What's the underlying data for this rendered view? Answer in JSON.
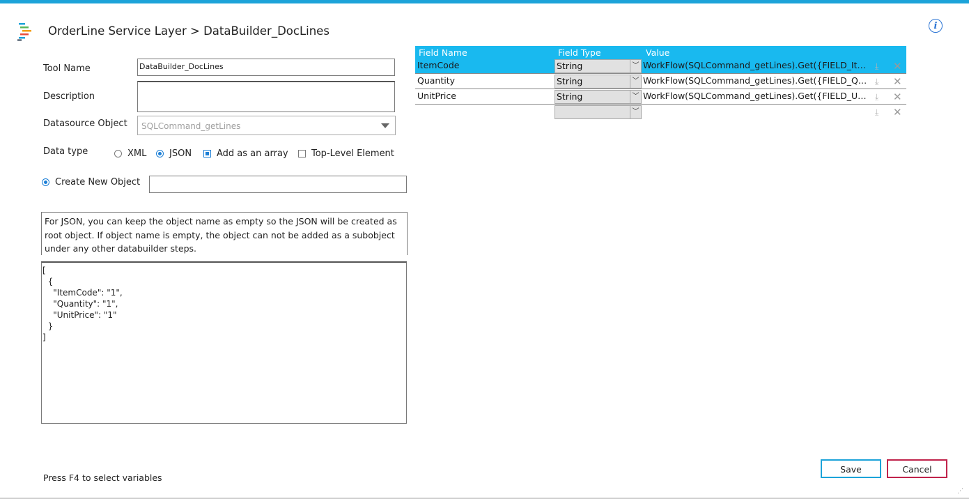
{
  "header": {
    "title": "OrderLine Service Layer > DataBuilder_DocLines"
  },
  "form": {
    "tool_name_label": "Tool Name",
    "tool_name_value": "DataBuilder_DocLines",
    "description_label": "Description",
    "description_value": "",
    "datasource_label": "Datasource Object",
    "datasource_value": "SQLCommand_getLines",
    "data_type_label": "Data type",
    "xml_label": "XML",
    "json_label": "JSON",
    "add_array_label": "Add as an array",
    "top_level_label": "Top-Level Element",
    "create_new_label": "Create New Object",
    "create_new_value": "",
    "note": "For JSON, you can keep the object name as empty so the JSON will be created as root object.  If object name is empty, the object can not be added as a subobject under any other databuilder steps.",
    "preview": "[\n  {\n    \"ItemCode\": \"1\",\n    \"Quantity\": \"1\",\n    \"UnitPrice\": \"1\"\n  }\n]"
  },
  "grid": {
    "headers": {
      "field_name": "Field Name",
      "field_type": "Field Type",
      "value": "Value"
    },
    "rows": [
      {
        "name": "ItemCode",
        "type": "String",
        "value": "WorkFlow(SQLCommand_getLines).Get({FIELD_ItemCode})"
      },
      {
        "name": "Quantity",
        "type": "String",
        "value": "WorkFlow(SQLCommand_getLines).Get({FIELD_Quantity})"
      },
      {
        "name": "UnitPrice",
        "type": "String",
        "value": "WorkFlow(SQLCommand_getLines).Get({FIELD_UnitPrice})"
      },
      {
        "name": "",
        "type": "",
        "value": ""
      }
    ]
  },
  "footer": {
    "hint": "Press F4 to select variables"
  },
  "buttons": {
    "save": "Save",
    "cancel": "Cancel"
  },
  "colors": {
    "accent": "#19b9ef",
    "topbar": "#1ca3d9",
    "cancel_border": "#c0234b",
    "save_border": "#1ca3d9"
  },
  "icons": [
    "app-logo-icon",
    "info-icon",
    "chevron-down-icon",
    "download-icon",
    "close-icon"
  ]
}
